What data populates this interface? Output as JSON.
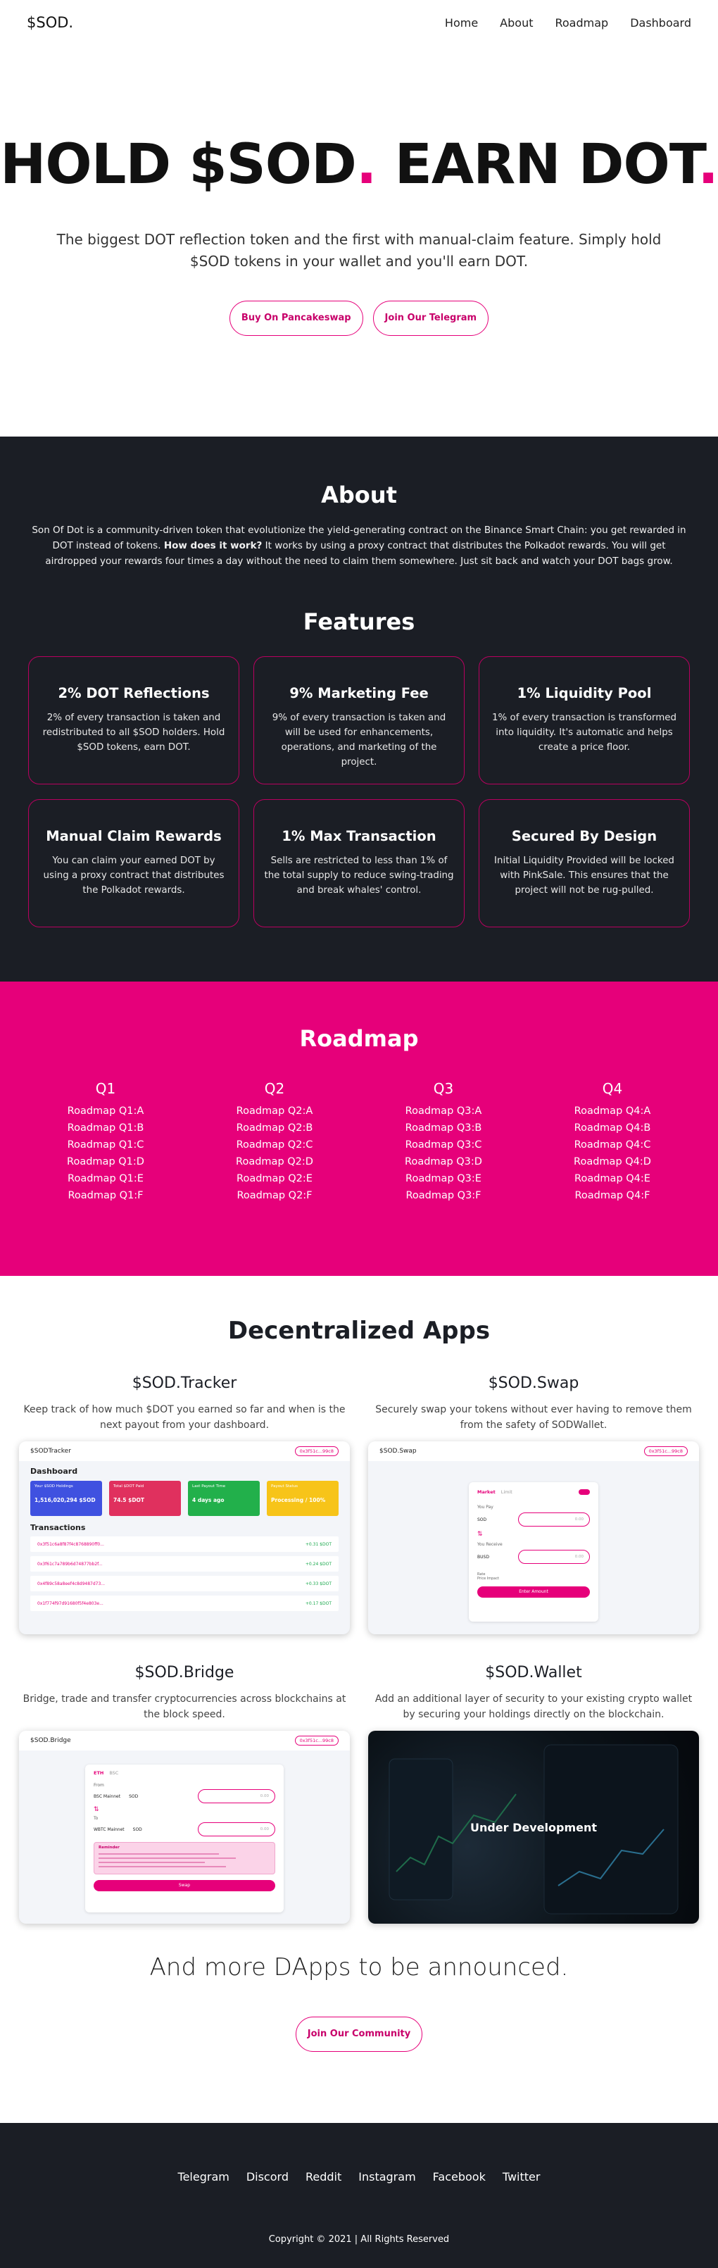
{
  "nav": {
    "logo": "$SOD.",
    "links": [
      "Home",
      "About",
      "Roadmap",
      "Dashboard"
    ]
  },
  "hero": {
    "title_a": "HOLD $SOD",
    "dot": ".",
    "title_b": " EARN DOT",
    "subtitle": "The biggest DOT reflection token and the first with manual-claim feature. Simply hold $SOD tokens in your wallet and you'll earn DOT.",
    "btn_buy": "Buy On Pancakeswap",
    "btn_telegram": "Join Our Telegram"
  },
  "about": {
    "title": "About",
    "text_1": "Son Of Dot is a community-driven token that evolutionize the yield-generating contract on the Binance Smart Chain: you get rewarded in DOT instead of tokens. ",
    "text_bold": "How does it work?",
    "text_2": " It works by using a proxy contract that distributes the Polkadot rewards. You will get airdropped your rewards four times a day without the need to claim them somewhere. Just sit back and watch your DOT bags grow."
  },
  "features": {
    "title": "Features",
    "items": [
      {
        "title": "2% DOT Reflections",
        "text": "2% of every transaction is taken and redistributed to all $SOD holders. Hold $SOD tokens, earn DOT."
      },
      {
        "title": "9% Marketing Fee",
        "text": "9% of every transaction is taken and will be used for enhancements, operations, and marketing of the project."
      },
      {
        "title": "1% Liquidity Pool",
        "text": "1% of every transaction is transformed into liquidity. It's automatic and helps create a price floor."
      },
      {
        "title": "Manual Claim Rewards",
        "text": "You can claim your earned DOT by using a proxy contract that distributes the Polkadot rewards."
      },
      {
        "title": "1% Max Transaction",
        "text": "Sells are restricted to less than 1% of the total supply to reduce swing-trading and break whales' control."
      },
      {
        "title": "Secured By Design",
        "text": "Initial Liquidity Provided will be locked with PinkSale. This ensures that the project will not be rug-pulled."
      }
    ]
  },
  "roadmap": {
    "title": "Roadmap",
    "quarters": [
      {
        "name": "Q1",
        "items": [
          "Roadmap Q1:A",
          "Roadmap Q1:B",
          "Roadmap Q1:C",
          "Roadmap Q1:D",
          "Roadmap Q1:E",
          "Roadmap Q1:F"
        ]
      },
      {
        "name": "Q2",
        "items": [
          "Roadmap Q2:A",
          "Roadmap Q2:B",
          "Roadmap Q2:C",
          "Roadmap Q2:D",
          "Roadmap Q2:E",
          "Roadmap Q2:F"
        ]
      },
      {
        "name": "Q3",
        "items": [
          "Roadmap Q3:A",
          "Roadmap Q3:B",
          "Roadmap Q3:C",
          "Roadmap Q3:D",
          "Roadmap Q3:E",
          "Roadmap Q3:F"
        ]
      },
      {
        "name": "Q4",
        "items": [
          "Roadmap Q4:A",
          "Roadmap Q4:B",
          "Roadmap Q4:C",
          "Roadmap Q4:D",
          "Roadmap Q4:E",
          "Roadmap Q4:F"
        ]
      }
    ]
  },
  "dapps": {
    "title": "Decentralized Apps",
    "tracker": {
      "title": "$SOD.Tracker",
      "text": "Keep track of how much $DOT you earned so far and when is the next payout from your dashboard.",
      "app_name": "$SODTracker",
      "wallet_pill": "0x3f51c...99c8",
      "dashboard": "Dashboard",
      "cards": [
        {
          "label": "Your $SOD Holdings",
          "value": "1,516,020,294 $SOD",
          "color": "#3f51e0"
        },
        {
          "label": "Total $DOT Paid",
          "value": "74.5 $DOT",
          "color": "#e0305e"
        },
        {
          "label": "Last Payout Time",
          "value": "4 days ago",
          "color": "#22b04b"
        },
        {
          "label": "Payout Status",
          "value": "Processing / 100%",
          "color": "#f7c419"
        }
      ],
      "transactions": "Transactions",
      "rows": [
        {
          "hash": "0x3f51c6a8f87f4c8768890ff0...",
          "amount": "+0.31 $DOT"
        },
        {
          "hash": "0x3f61c7a789b6d74877bb2f...",
          "amount": "+0.24 $DOT"
        },
        {
          "hash": "0x4f89c58a8eef4c8d9487d73...",
          "amount": "+0.33 $DOT"
        },
        {
          "hash": "0x1f774f97d91680f5f4e803e...",
          "amount": "+0.17 $DOT"
        }
      ]
    },
    "swap": {
      "title": "$SOD.Swap",
      "text": "Securely swap your tokens without ever having to remove them from the safety of SODWallet.",
      "app_name": "$SOD.Swap",
      "wallet_pill": "0x3f51c...99c8",
      "tab_market": "Market",
      "tab_limit": "Limit",
      "you_pay": "You Pay",
      "you_receive": "You Receive",
      "token_a": "SOD",
      "token_b": "BUSD",
      "amount_placeholder": "0.00",
      "rate": "Rate",
      "price_impact": "Price Impact",
      "button": "Enter Amount"
    },
    "bridge": {
      "title": "$SOD.Bridge",
      "text": "Bridge, trade and transfer cryptocurrencies across blockchains at the block speed.",
      "app_name": "$SOD.Bridge",
      "wallet_pill": "0x3f51c...99c8",
      "tab_a": "ETH",
      "tab_b": "BSC",
      "from": "From",
      "to": "To",
      "chain_a": "BSC Mainnet",
      "chain_b": "WBTC Mainnet",
      "token": "SOD",
      "amount_placeholder": "0.00",
      "warning_title": "Reminder",
      "button": "Swap"
    },
    "wallet": {
      "title": "$SOD.Wallet",
      "text": "Add an additional layer of security to your existing crypto wallet by securing your holdings directly on the blockchain.",
      "overlay": "Under Development"
    },
    "more": "And more DApps to be announced.",
    "community_btn": "Join Our Community"
  },
  "footer": {
    "links": [
      "Telegram",
      "Discord",
      "Reddit",
      "Instagram",
      "Facebook",
      "Twitter"
    ],
    "copyright": "Copyright © 2021 | All Rights Reserved"
  }
}
